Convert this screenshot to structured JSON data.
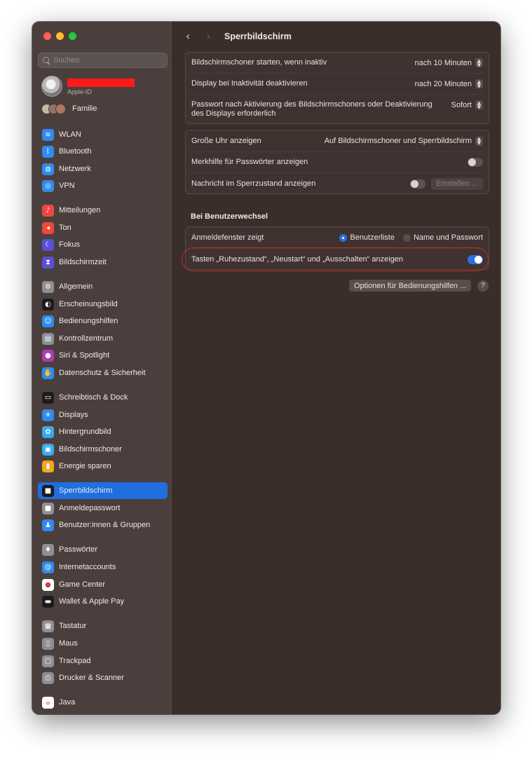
{
  "window": {
    "title": "Sperrbildschirm"
  },
  "sidebar": {
    "search_placeholder": "Suchen",
    "profile": {
      "subtitle": "Apple-ID"
    },
    "family_label": "Familie",
    "items": [
      {
        "label": "WLAN",
        "icon": "wifi-icon",
        "color": "#2e8bf0"
      },
      {
        "label": "Bluetooth",
        "icon": "bluetooth-icon",
        "color": "#2e8bf0"
      },
      {
        "label": "Netzwerk",
        "icon": "globe-icon",
        "color": "#2e8bf0"
      },
      {
        "label": "VPN",
        "icon": "vpn-icon",
        "color": "#2e8bf0"
      },
      {
        "label": "Mitteilungen",
        "icon": "bell-icon",
        "color": "#f0463c"
      },
      {
        "label": "Ton",
        "icon": "speaker-icon",
        "color": "#f0463c"
      },
      {
        "label": "Fokus",
        "icon": "moon-icon",
        "color": "#5a4fd6"
      },
      {
        "label": "Bildschirmzeit",
        "icon": "hourglass-icon",
        "color": "#5a4fd6"
      },
      {
        "label": "Allgemein",
        "icon": "gear-icon",
        "color": "#8e8e93"
      },
      {
        "label": "Erscheinungsbild",
        "icon": "appearance-icon",
        "color": "#1c1c1e"
      },
      {
        "label": "Bedienungshilfen",
        "icon": "accessibility-icon",
        "color": "#2e8bf0"
      },
      {
        "label": "Kontrollzentrum",
        "icon": "control-center-icon",
        "color": "#8e8e93"
      },
      {
        "label": "Siri & Spotlight",
        "icon": "siri-icon",
        "color": "#b03ab8"
      },
      {
        "label": "Datenschutz & Sicherheit",
        "icon": "hand-icon",
        "color": "#2e8bf0"
      },
      {
        "label": "Schreibtisch & Dock",
        "icon": "dock-icon",
        "color": "#1c1c1e"
      },
      {
        "label": "Displays",
        "icon": "display-icon",
        "color": "#2e8bf0"
      },
      {
        "label": "Hintergrundbild",
        "icon": "wallpaper-icon",
        "color": "#35aaf2"
      },
      {
        "label": "Bildschirmschoner",
        "icon": "screensaver-icon",
        "color": "#35aaf2"
      },
      {
        "label": "Energie sparen",
        "icon": "battery-icon",
        "color": "#f5a623"
      },
      {
        "label": "Sperrbildschirm",
        "icon": "lock-icon",
        "color": "#1c1c1e"
      },
      {
        "label": "Anmeldepasswort",
        "icon": "lock-icon",
        "color": "#8e8e93"
      },
      {
        "label": "Benutzer:innen & Gruppen",
        "icon": "users-icon",
        "color": "#2e8bf0"
      },
      {
        "label": "Passwörter",
        "icon": "key-icon",
        "color": "#8e8e93"
      },
      {
        "label": "Internetaccounts",
        "icon": "at-icon",
        "color": "#2e8bf0"
      },
      {
        "label": "Game Center",
        "icon": "game-center-icon",
        "color": "#ffffff"
      },
      {
        "label": "Wallet & Apple Pay",
        "icon": "wallet-icon",
        "color": "#1c1c1e"
      },
      {
        "label": "Tastatur",
        "icon": "keyboard-icon",
        "color": "#8e8e93"
      },
      {
        "label": "Maus",
        "icon": "mouse-icon",
        "color": "#8e8e93"
      },
      {
        "label": "Trackpad",
        "icon": "trackpad-icon",
        "color": "#8e8e93"
      },
      {
        "label": "Drucker & Scanner",
        "icon": "printer-icon",
        "color": "#8e8e93"
      },
      {
        "label": "Java",
        "icon": "java-icon",
        "color": "#ffffff"
      }
    ],
    "active_index": 19
  },
  "settings": {
    "group1": [
      {
        "label": "Bildschirmschoner starten, wenn inaktiv",
        "value": "nach 10 Minuten"
      },
      {
        "label": "Display bei Inaktivität deaktivieren",
        "value": "nach 20 Minuten"
      },
      {
        "label": "Passwort nach Aktivierung des Bildschirmschoners oder Deaktivierung des Displays erforderlich",
        "value": "Sofort"
      }
    ],
    "group2": {
      "clock_label": "Große Uhr anzeigen",
      "clock_value": "Auf Bildschirmschoner und Sperrbildschirm",
      "hint_label": "Merkhilfe für Passwörter anzeigen",
      "hint_on": false,
      "message_label": "Nachricht im Sperrzustand anzeigen",
      "message_on": false,
      "message_button": "Einstellen ..."
    },
    "section_title": "Bei Benutzerwechsel",
    "group3": {
      "login_window_label": "Anmeldefenster zeigt",
      "option_list": "Benutzerliste",
      "option_name": "Name und Passwort",
      "selected": "Benutzerliste",
      "buttons_label": "Tasten „Ruhezustand“, „Neustart“ und „Ausschalten“ anzeigen",
      "buttons_on": true
    },
    "accessibility_button": "Optionen für Bedienungshilfen ...",
    "help_label": "?"
  },
  "colors": {
    "accent": "#2c6fe3",
    "highlight_ring": "#c2301f",
    "redaction": "#ff1a1a"
  }
}
